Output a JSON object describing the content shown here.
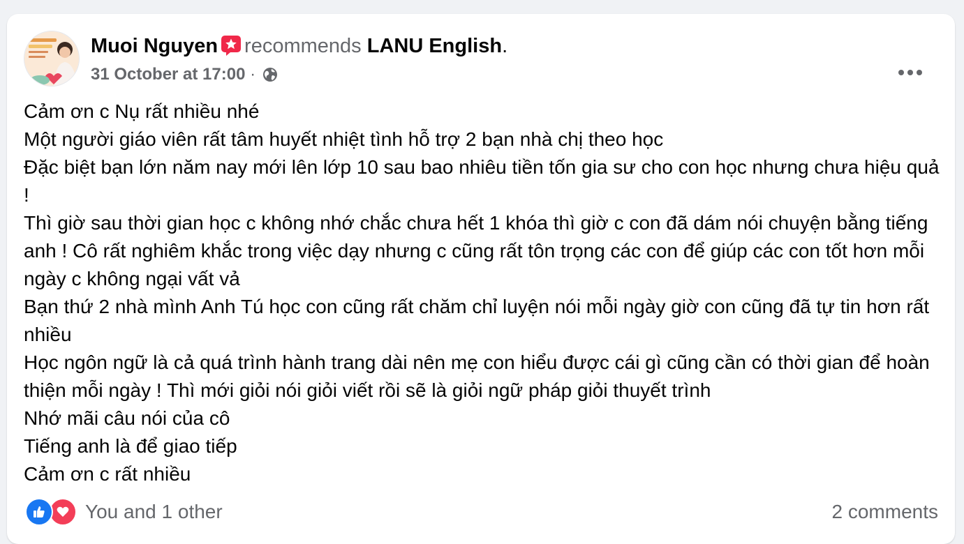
{
  "post": {
    "author": "Muoi Nguyen",
    "action": "recommends",
    "page_name": "LANU English",
    "page_suffix": ".",
    "timestamp": "31 October at 17:00",
    "separator": "·",
    "privacy_icon": "globe-icon",
    "recommend_icon": "recommend-star-icon",
    "more_icon": "more-dots-icon",
    "body_lines": [
      "Cảm ơn c Nụ rất nhiều nhé",
      "Một người giáo viên rất tâm huyết nhiệt tình hỗ trợ 2 bạn nhà chị theo học",
      "Đặc biệt bạn lớn năm nay mới lên lớp 10 sau bao nhiêu tiền tốn gia sư cho con học nhưng chưa hiệu quả !",
      "Thì giờ sau thời gian học c không nhớ chắc chưa hết 1 khóa thì giờ c con đã dám nói chuyện bằng tiếng anh ! Cô rất nghiêm khắc trong việc dạy nhưng c cũng rất tôn trọng các con để giúp các con tốt hơn mỗi ngày c không ngại vất vả",
      "Bạn thứ 2 nhà mình Anh Tú học con cũng rất chăm chỉ luyện nói mỗi ngày giờ con cũng đã tự tin hơn rất nhiều",
      "Học ngôn ngữ là cả quá trình hành trang dài nên mẹ con hiểu được cái gì cũng cần có thời gian để hoàn thiện mỗi ngày ! Thì mới giỏi nói giỏi viết rồi sẽ là giỏi ngữ pháp giỏi thuyết trình",
      "Nhớ mãi câu nói của cô",
      "Tiếng anh là để giao tiếp",
      "Cảm ơn c rất nhiều"
    ]
  },
  "footer": {
    "reactions_text": "You and 1 other",
    "reaction_icons": [
      "like-icon",
      "love-icon"
    ],
    "comments_text": "2 comments"
  },
  "colors": {
    "like_blue": "#1877f2",
    "love_red": "#f33e58",
    "secondary_text": "#65676b",
    "primary_text": "#050505"
  }
}
